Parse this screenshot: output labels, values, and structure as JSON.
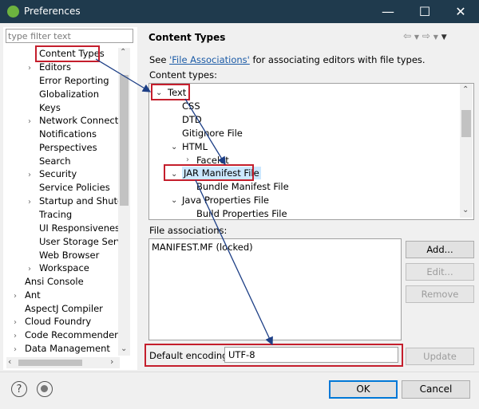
{
  "window": {
    "title": "Preferences",
    "minimize": "—",
    "maximize": "☐",
    "close": "✕"
  },
  "sidebar": {
    "filter_placeholder": "type filter text",
    "items": [
      {
        "label": "Content Types"
      },
      {
        "label": "Editors"
      },
      {
        "label": "Error Reporting"
      },
      {
        "label": "Globalization"
      },
      {
        "label": "Keys"
      },
      {
        "label": "Network Connection"
      },
      {
        "label": "Notifications"
      },
      {
        "label": "Perspectives"
      },
      {
        "label": "Search"
      },
      {
        "label": "Security"
      },
      {
        "label": "Service Policies"
      },
      {
        "label": "Startup and Shutdo"
      },
      {
        "label": "Tracing"
      },
      {
        "label": "UI Responsiveness M"
      },
      {
        "label": "User Storage Service"
      },
      {
        "label": "Web Browser"
      },
      {
        "label": "Workspace"
      },
      {
        "label": "Ansi Console"
      },
      {
        "label": "Ant"
      },
      {
        "label": "AspectJ Compiler"
      },
      {
        "label": "Cloud Foundry"
      },
      {
        "label": "Code Recommenders"
      },
      {
        "label": "Data Management"
      }
    ]
  },
  "page": {
    "title": "Content Types",
    "see_prefix": "See ",
    "see_link": "'File Associations'",
    "see_suffix": " for associating editors with file types.",
    "content_types_label": "Content types:",
    "content_types": [
      {
        "label": "Text"
      },
      {
        "label": "CSS"
      },
      {
        "label": "DTD"
      },
      {
        "label": "Gitignore File"
      },
      {
        "label": "HTML"
      },
      {
        "label": "Facelet"
      },
      {
        "label": "JAR Manifest File"
      },
      {
        "label": "Bundle Manifest File"
      },
      {
        "label": "Java Properties File"
      },
      {
        "label": "Build Properties File"
      }
    ],
    "file_assoc_label": "File associations:",
    "file_assoc": [
      "MANIFEST.MF (locked)"
    ],
    "buttons": {
      "add": "Add...",
      "edit": "Edit...",
      "remove": "Remove",
      "update": "Update"
    },
    "encoding_label": "Default encoding:",
    "encoding_value": "UTF-8"
  },
  "footer": {
    "ok": "OK",
    "cancel": "Cancel",
    "help": "?"
  },
  "colors": {
    "titlebar": "#1f3a4d",
    "highlight": "#c41e2c",
    "link": "#1a5aa6",
    "arrow": "#1d3f86"
  }
}
